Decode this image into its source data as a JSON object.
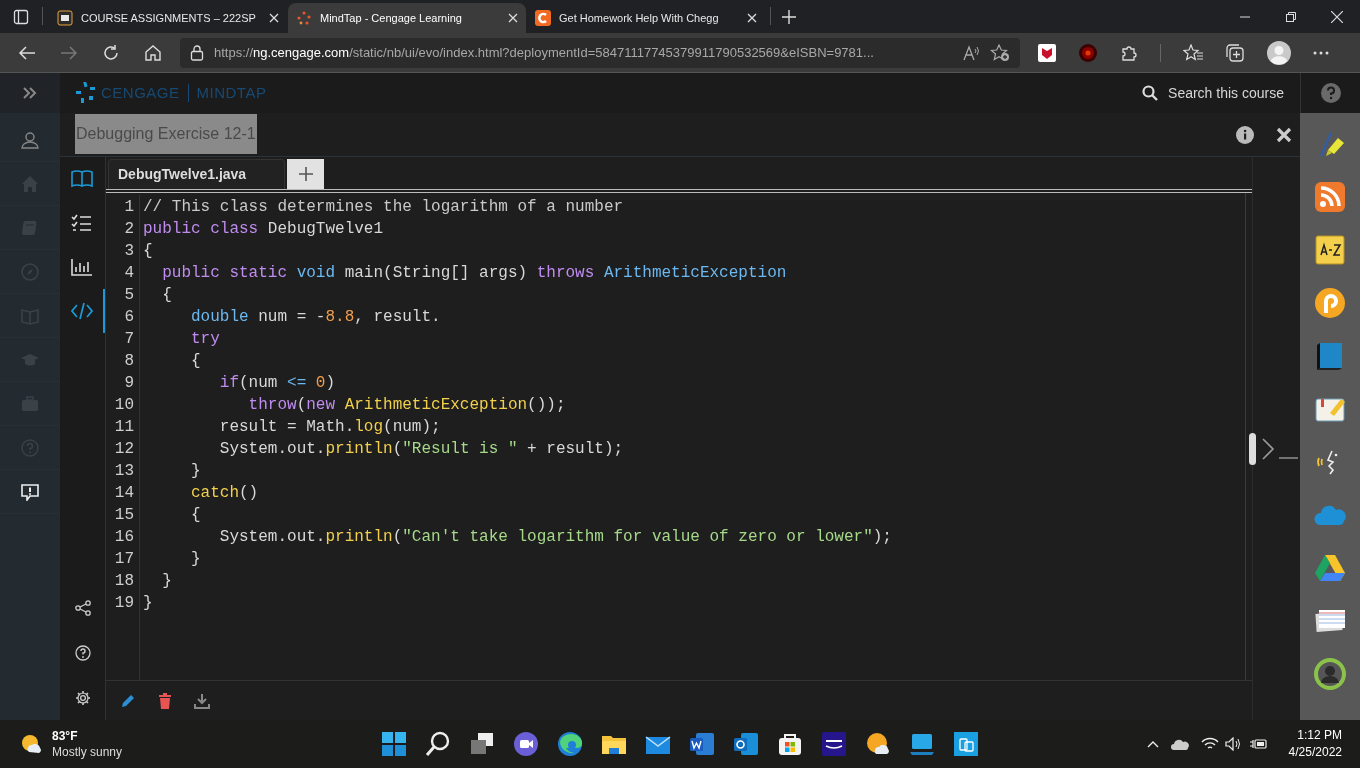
{
  "browser": {
    "tabs": [
      {
        "title": "COURSE ASSIGNMENTS – 222SP",
        "selected": false
      },
      {
        "title": "MindTap - Cengage Learning",
        "selected": true
      },
      {
        "title": "Get Homework Help With Chegg",
        "selected": false
      }
    ],
    "address": {
      "scheme": "https://",
      "host": "ng.cengage.com",
      "path": "/static/nb/ui/evo/index.html?deploymentId=58471117745379911790532569&eISBN=9781..."
    }
  },
  "app": {
    "logo": {
      "brand": "CENGAGE",
      "product": "MINDTAP"
    },
    "search": "Search this course"
  },
  "activity": {
    "title": "Debugging Exercise 12-1"
  },
  "editor_rail": [
    {
      "selected": false
    },
    {
      "selected": false
    },
    {
      "selected": false
    },
    {
      "selected": true
    }
  ],
  "editor": {
    "files": [
      {
        "name": "DebugTwelve1.java",
        "selected": true
      }
    ],
    "lines": [
      {
        "number": "1",
        "tokens": [
          {
            "text": "// This class determines the logarithm of a number",
            "kind": "comment"
          }
        ]
      },
      {
        "number": "2",
        "tokens": [
          {
            "text": "public class",
            "kind": "keyword"
          },
          {
            "text": " DebugTwelve1",
            "kind": "plain"
          }
        ]
      },
      {
        "number": "3",
        "tokens": [
          {
            "text": "{",
            "kind": "plain"
          }
        ]
      },
      {
        "number": "4",
        "tokens": [
          {
            "text": "  public static",
            "kind": "keyword"
          },
          {
            "text": " void",
            "kind": "type"
          },
          {
            "text": " main(String[] args) ",
            "kind": "plain"
          },
          {
            "text": "throws",
            "kind": "keyword"
          },
          {
            "text": " ArithmeticException",
            "kind": "type"
          }
        ]
      },
      {
        "number": "5",
        "tokens": [
          {
            "text": "  {",
            "kind": "plain"
          }
        ]
      },
      {
        "number": "6",
        "tokens": [
          {
            "text": "     double",
            "kind": "type"
          },
          {
            "text": " num = -",
            "kind": "plain"
          },
          {
            "text": "8.8",
            "kind": "number"
          },
          {
            "text": ", result.",
            "kind": "plain"
          }
        ]
      },
      {
        "number": "7",
        "tokens": [
          {
            "text": "     try",
            "kind": "keyword"
          }
        ]
      },
      {
        "number": "8",
        "tokens": [
          {
            "text": "     {",
            "kind": "plain"
          }
        ]
      },
      {
        "number": "9",
        "tokens": [
          {
            "text": "        if",
            "kind": "keyword"
          },
          {
            "text": "(num ",
            "kind": "plain"
          },
          {
            "text": "<=",
            "kind": "type"
          },
          {
            "text": " 0",
            "kind": "number"
          },
          {
            "text": ")",
            "kind": "plain"
          }
        ]
      },
      {
        "number": "10",
        "tokens": [
          {
            "text": "           throw",
            "kind": "keyword"
          },
          {
            "text": "(",
            "kind": "plain"
          },
          {
            "text": "new",
            "kind": "keyword"
          },
          {
            "text": " ArithmeticException",
            "kind": "func"
          },
          {
            "text": "());",
            "kind": "plain"
          }
        ]
      },
      {
        "number": "11",
        "tokens": [
          {
            "text": "        result = Math.",
            "kind": "plain"
          },
          {
            "text": "log",
            "kind": "func"
          },
          {
            "text": "(num);",
            "kind": "plain"
          }
        ]
      },
      {
        "number": "12",
        "tokens": [
          {
            "text": "        System.out.",
            "kind": "plain"
          },
          {
            "text": "println",
            "kind": "func"
          },
          {
            "text": "(",
            "kind": "plain"
          },
          {
            "text": "\"Result is \"",
            "kind": "string"
          },
          {
            "text": " + result);",
            "kind": "plain"
          }
        ]
      },
      {
        "number": "13",
        "tokens": [
          {
            "text": "     }",
            "kind": "plain"
          }
        ]
      },
      {
        "number": "14",
        "tokens": [
          {
            "text": "     catch",
            "kind": "func"
          },
          {
            "text": "()",
            "kind": "plain"
          }
        ]
      },
      {
        "number": "15",
        "tokens": [
          {
            "text": "     {",
            "kind": "plain"
          }
        ]
      },
      {
        "number": "16",
        "tokens": [
          {
            "text": "        System.out.",
            "kind": "plain"
          },
          {
            "text": "println",
            "kind": "func"
          },
          {
            "text": "(",
            "kind": "plain"
          },
          {
            "text": "\"Can't take logarithm for value of zero or lower\"",
            "kind": "string"
          },
          {
            "text": ");",
            "kind": "plain"
          }
        ]
      },
      {
        "number": "17",
        "tokens": [
          {
            "text": "     }",
            "kind": "plain"
          }
        ]
      },
      {
        "number": "18",
        "tokens": [
          {
            "text": "  }",
            "kind": "plain"
          }
        ]
      },
      {
        "number": "19",
        "tokens": [
          {
            "text": "}",
            "kind": "plain"
          }
        ]
      }
    ]
  },
  "taskbar": {
    "weather": {
      "temperature": "83°F",
      "condition": "Mostly sunny"
    },
    "time": "1:12 PM",
    "date": "4/25/2022"
  }
}
